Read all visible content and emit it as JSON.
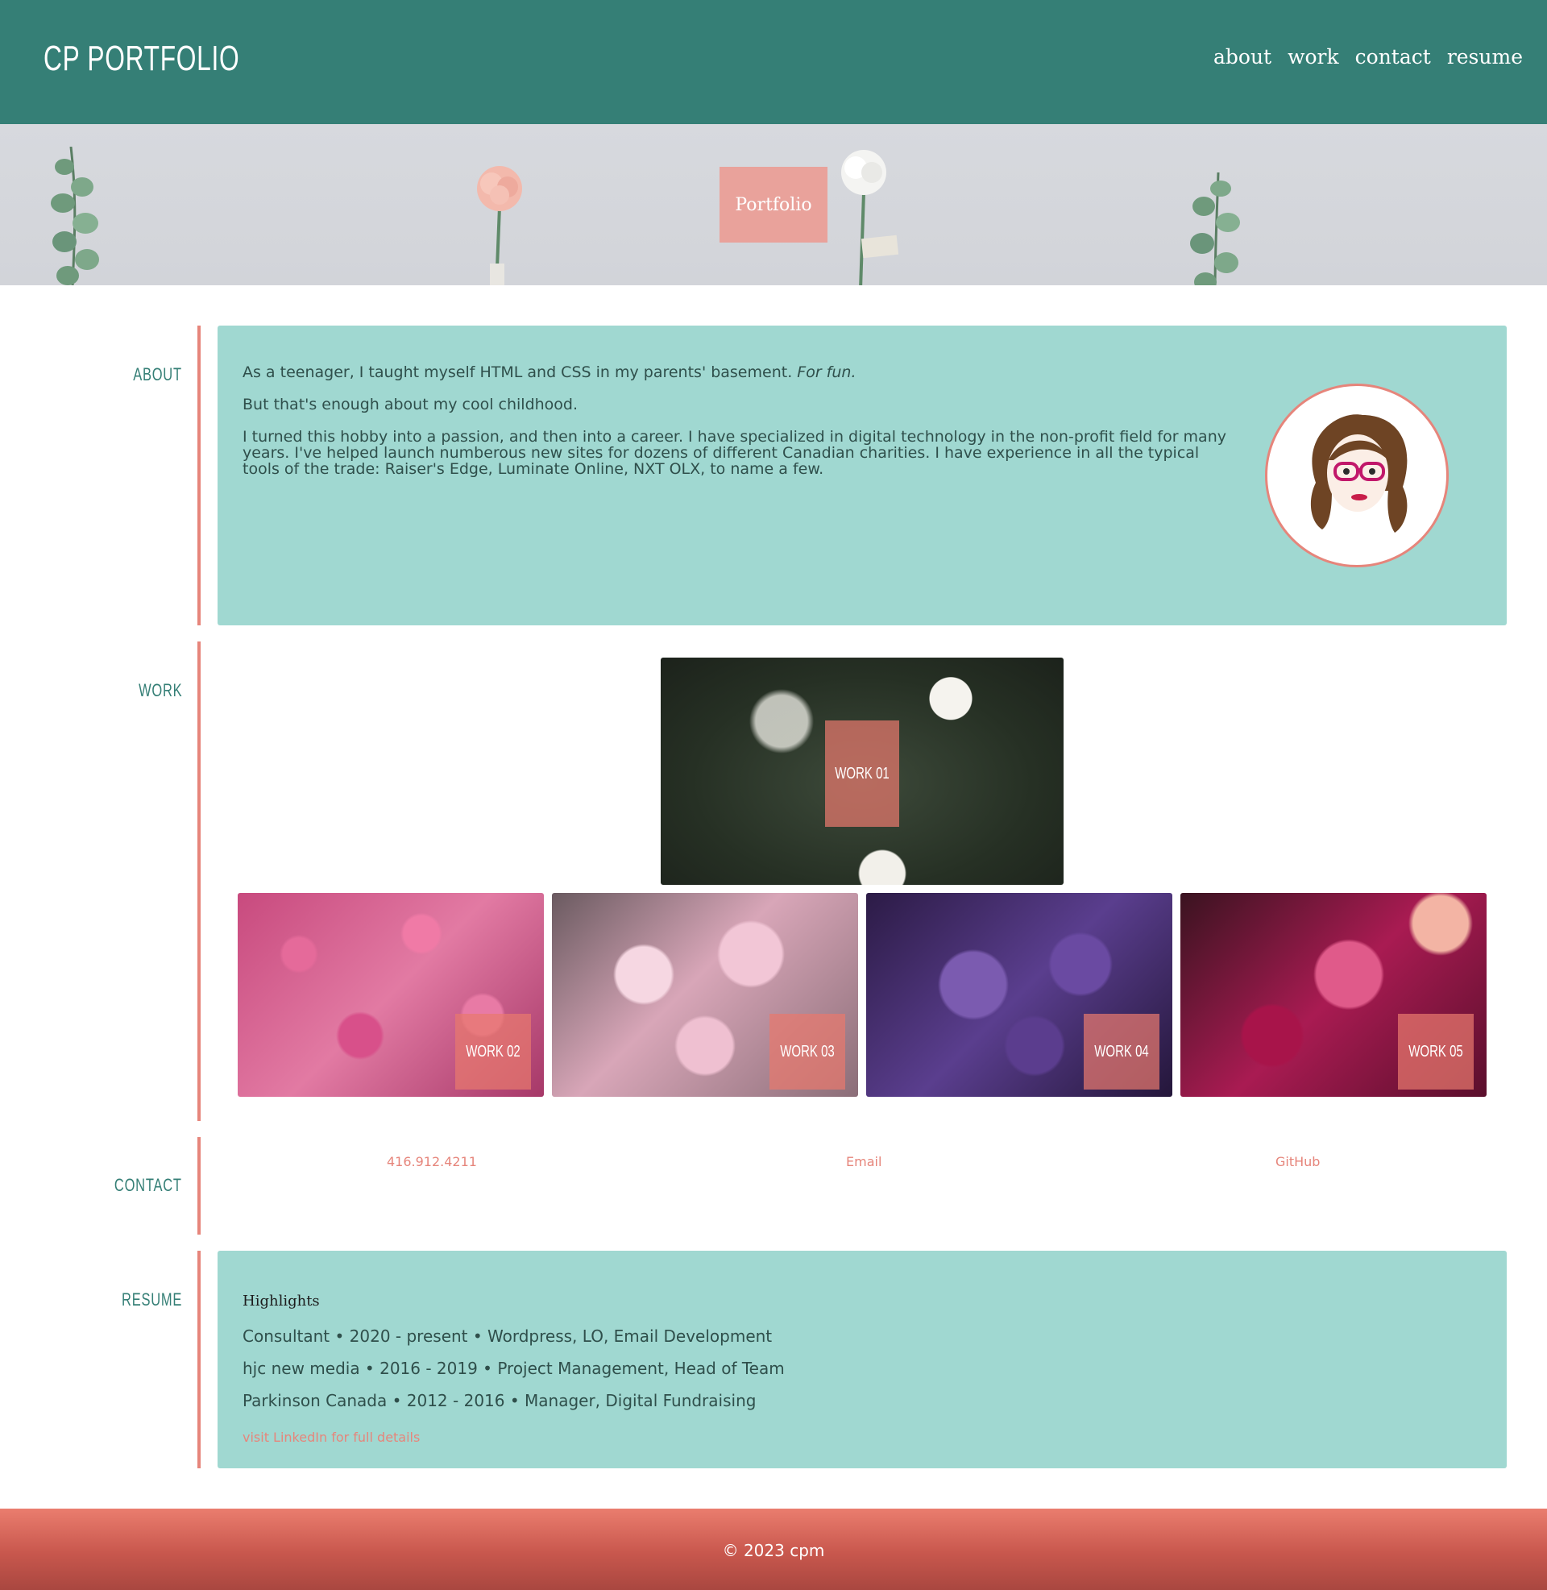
{
  "header": {
    "logo": "CP PORTFOLIO",
    "nav": [
      "about",
      "work",
      "contact",
      "resume"
    ]
  },
  "hero": {
    "badge": "Portfolio"
  },
  "sections": {
    "about": "ABOUT",
    "work": "WORK",
    "contact": "CONTACT",
    "resume": "RESUME"
  },
  "about": {
    "p1": "As a teenager, I taught myself HTML and CSS in my parents' basement.",
    "p1_em": "For fun.",
    "p2": "But that's enough about my cool childhood.",
    "p3": "I turned this hobby into a passion, and then into a career. I have specialized in digital technology in the non-profit field for many years. I've helped launch numberous new sites for dozens of different Canadian charities. I have experience in all the typical tools of the trade: Raiser's Edge, Luminate Online, NXT OLX, to name a few."
  },
  "work": {
    "items": [
      "WORK 01",
      "WORK 02",
      "WORK 03",
      "WORK 04",
      "WORK 05"
    ]
  },
  "contact": {
    "phone": "416.912.4211",
    "email": "Email",
    "github": "GitHub"
  },
  "resume": {
    "heading": "Highlights",
    "rows": [
      "Consultant • 2020 - present • Wordpress, LO, Email Development",
      "hjc new media • 2016 - 2019 • Project Management, Head of Team",
      "Parkinson Canada • 2012 - 2016 • Manager, Digital Fundraising"
    ],
    "linkedin": "visit LinkedIn for full details"
  },
  "footer": {
    "copyright": "© 2023 cpm"
  },
  "colors": {
    "header_bg": "#357f76",
    "accent": "#e6857b",
    "card_bg": "#a0d8d1",
    "badge_bg": "#e9a29b"
  }
}
